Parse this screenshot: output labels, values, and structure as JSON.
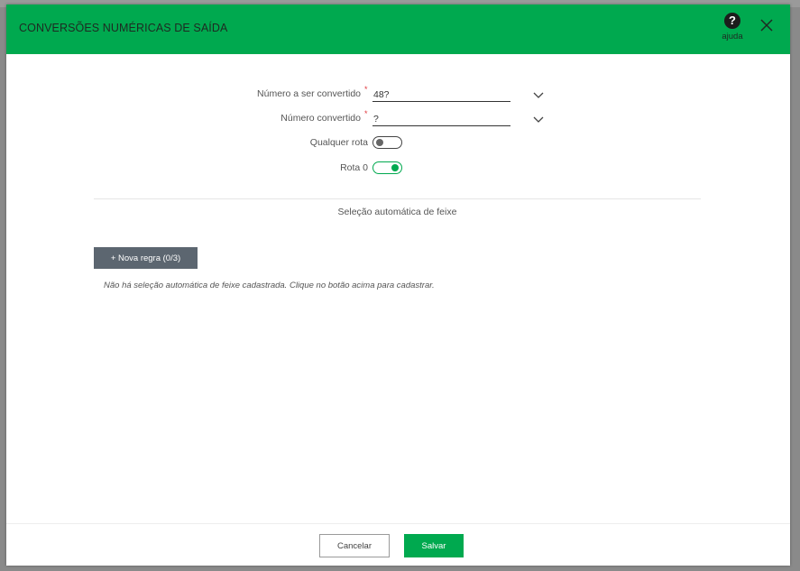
{
  "header": {
    "title": "CONVERSÕES NUMÉRICAS DE SAÍDA",
    "help_label": "ajuda",
    "help_icon": "question-circle-icon",
    "close_icon": "close-icon",
    "background_color": "#00a94f"
  },
  "form": {
    "number_to_convert": {
      "label": "Número a ser convertido",
      "required_mark": "*",
      "value": "48?"
    },
    "converted_number": {
      "label": "Número convertido",
      "required_mark": "*",
      "value": "?"
    },
    "any_route": {
      "label": "Qualquer rota",
      "checked": false
    },
    "route_0": {
      "label": "Rota 0",
      "checked": true
    }
  },
  "section": {
    "title": "Seleção automática de feixe",
    "new_rule_label": "+ Nova regra (0/3)",
    "empty_message": "Não há seleção automática de feixe cadastrada. Clique no botão acima para cadastrar."
  },
  "footer": {
    "cancel_label": "Cancelar",
    "save_label": "Salvar"
  },
  "colors": {
    "accent": "#00a94f",
    "secondary_button": "#5c6670",
    "required": "#e0393e"
  }
}
